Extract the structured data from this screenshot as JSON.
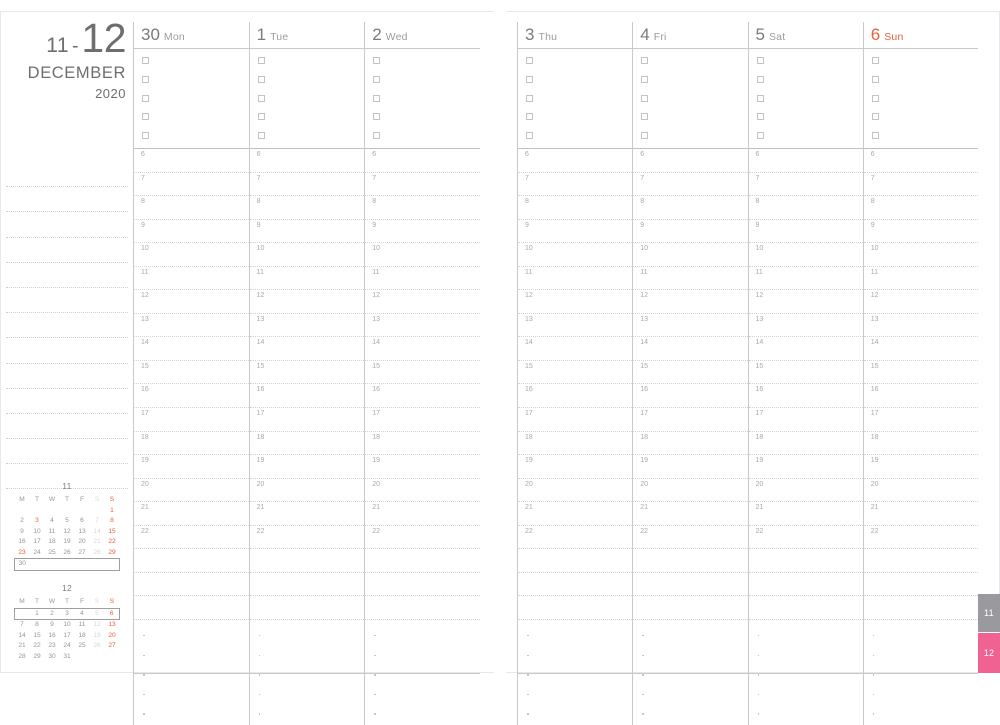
{
  "document": {
    "type": "weekly-planner-spread",
    "year": "2020"
  },
  "month_title": {
    "prev_month": "11",
    "dash": "-",
    "current_month": "12",
    "month_name": "DECEMBER",
    "year": "2020"
  },
  "colors": {
    "sunday_red": "#e8603c",
    "rule_gray": "#c9c9cd",
    "dotted_gray": "#d2d2d7",
    "text_gray": "#77777a",
    "tab_gray": "#9a9a9e",
    "tab_pink": "#f06292"
  },
  "left_page": {
    "margin_line_count": 13,
    "days": [
      {
        "num": "30",
        "weekday": "Mon",
        "is_sunday": false,
        "checkbox_count": 5
      },
      {
        "num": "1",
        "weekday": "Tue",
        "is_sunday": false,
        "checkbox_count": 5
      },
      {
        "num": "2",
        "weekday": "Wed",
        "is_sunday": false,
        "checkbox_count": 5
      }
    ]
  },
  "right_page": {
    "days": [
      {
        "num": "3",
        "weekday": "Thu",
        "is_sunday": false,
        "checkbox_count": 5
      },
      {
        "num": "4",
        "weekday": "Fri",
        "is_sunday": false,
        "checkbox_count": 5
      },
      {
        "num": "5",
        "weekday": "Sat",
        "is_sunday": false,
        "checkbox_count": 5
      },
      {
        "num": "6",
        "weekday": "Sun",
        "is_sunday": true,
        "checkbox_count": 5
      }
    ]
  },
  "hours": [
    "6",
    "7",
    "8",
    "9",
    "10",
    "11",
    "12",
    "13",
    "14",
    "15",
    "16",
    "17",
    "18",
    "19",
    "20",
    "21",
    "22"
  ],
  "spacer_row_count": 3,
  "note_dot_row_count": 5,
  "mini_calendars": [
    {
      "id": "mini-nov",
      "title": "11",
      "weekday_headers": [
        "M",
        "T",
        "W",
        "T",
        "F",
        "S",
        "S"
      ],
      "weeks": [
        [
          "",
          "",
          "",
          "",
          "",
          "",
          "1"
        ],
        [
          "2",
          "3",
          "4",
          "5",
          "6",
          "7",
          "8"
        ],
        [
          "9",
          "10",
          "11",
          "12",
          "13",
          "14",
          "15"
        ],
        [
          "16",
          "17",
          "18",
          "19",
          "20",
          "21",
          "22"
        ],
        [
          "23",
          "24",
          "25",
          "26",
          "27",
          "28",
          "29"
        ],
        [
          "30",
          "",
          "",
          "",
          "",
          "",
          ""
        ]
      ],
      "highlight_week_index": 5,
      "holidays": [
        "3",
        "23"
      ]
    },
    {
      "id": "mini-dec",
      "title": "12",
      "weekday_headers": [
        "M",
        "T",
        "W",
        "T",
        "F",
        "S",
        "S"
      ],
      "weeks": [
        [
          "",
          "1",
          "2",
          "3",
          "4",
          "5",
          "6"
        ],
        [
          "7",
          "8",
          "9",
          "10",
          "11",
          "12",
          "13"
        ],
        [
          "14",
          "15",
          "16",
          "17",
          "18",
          "19",
          "20"
        ],
        [
          "21",
          "22",
          "23",
          "24",
          "25",
          "26",
          "27"
        ],
        [
          "28",
          "29",
          "30",
          "31",
          "",
          "",
          ""
        ]
      ],
      "highlight_week_index": 0,
      "holidays": []
    }
  ],
  "side_tabs": [
    {
      "label": "11",
      "color": "#9a9a9e",
      "name": "side-tab-month-11"
    },
    {
      "label": "12",
      "color": "#f06292",
      "name": "side-tab-month-12"
    }
  ]
}
